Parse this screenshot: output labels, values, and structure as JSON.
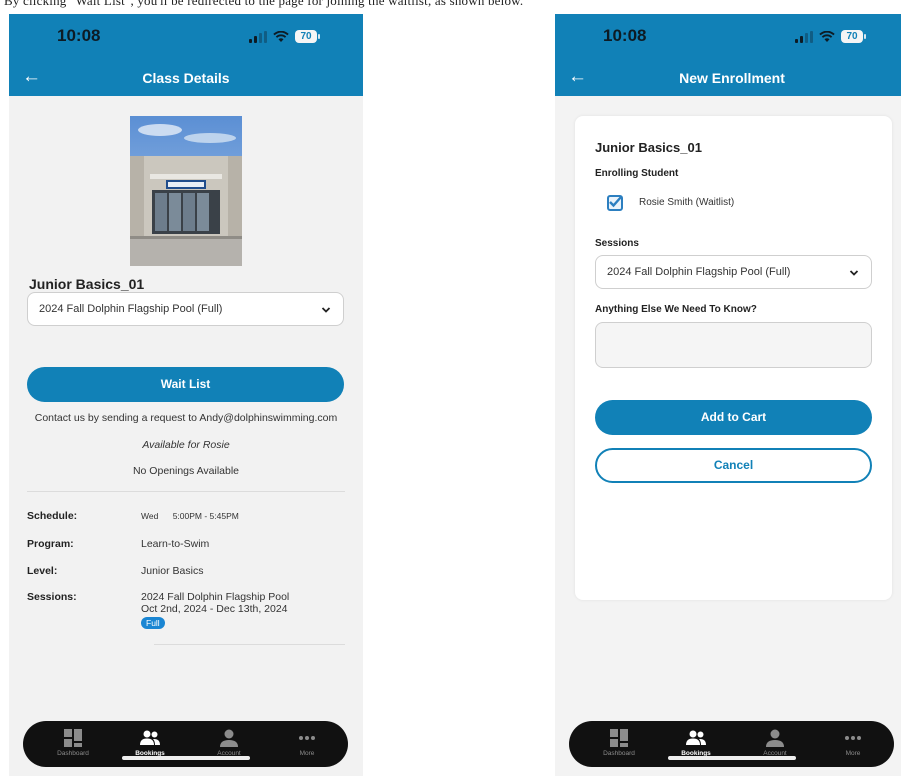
{
  "caption": "By clicking \"Wait List\", you'll be redirected to the page for joining the waitlist, as shown below.",
  "status_bar": {
    "time": "10:08",
    "battery": "70"
  },
  "class_details": {
    "nav_title": "Class Details",
    "class_name": "Junior Basics_01",
    "session_select": "2024 Fall Dolphin Flagship Pool (Full)",
    "waitlist_button": "Wait List",
    "contact_text": "Contact us by sending a request to Andy@dolphinswimming.com",
    "available_for": "Available for Rosie",
    "openings": "No Openings Available",
    "details": {
      "schedule_label": "Schedule:",
      "schedule_day": "Wed",
      "schedule_time": "5:00PM - 5:45PM",
      "program_label": "Program:",
      "program_value": "Learn-to-Swim",
      "level_label": "Level:",
      "level_value": "Junior Basics",
      "sessions_label": "Sessions:",
      "sessions_name": "2024 Fall Dolphin Flagship Pool",
      "sessions_dates": "Oct 2nd, 2024 - Dec 13th, 2024",
      "sessions_badge": "Full"
    }
  },
  "new_enrollment": {
    "nav_title": "New Enrollment",
    "class_name": "Junior Basics_01",
    "enrolling_label": "Enrolling Student",
    "student": "Rosie Smith (Waitlist)",
    "sessions_label": "Sessions",
    "session_select": "2024 Fall Dolphin Flagship Pool (Full)",
    "notes_label": "Anything Else We Need To Know?",
    "notes_value": "",
    "add_button": "Add to Cart",
    "cancel_button": "Cancel"
  },
  "tabbar": {
    "dashboard": "Dashboard",
    "bookings": "Bookings",
    "account": "Account",
    "more": "More"
  },
  "colors": {
    "brand": "#1181b7",
    "badge": "#1a86d3",
    "tabbar_bg": "#111111"
  }
}
